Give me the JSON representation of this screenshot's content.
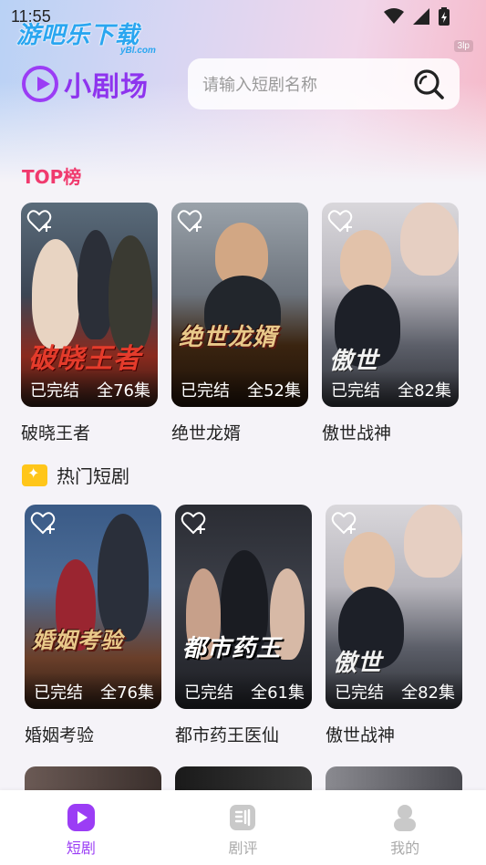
{
  "status_bar": {
    "time": "11:55"
  },
  "watermark": {
    "text": "游吧乐下载",
    "sub": "yBl.com"
  },
  "corner_badge": "3lp",
  "brand": {
    "name": "小剧场"
  },
  "search": {
    "placeholder": "请输入短剧名称"
  },
  "top_section": {
    "title": "TOP榜",
    "items": [
      {
        "title": "破晓王者",
        "art_title": "破晓王者",
        "status": "已完结",
        "episodes": "全76集"
      },
      {
        "title": "绝世龙婿",
        "art_title": "绝世龙婿",
        "status": "已完结",
        "episodes": "全52集"
      },
      {
        "title": "傲世战神",
        "art_title": "傲世",
        "status": "已完结",
        "episodes": "全82集"
      }
    ]
  },
  "hot_section": {
    "title": "热门短剧",
    "items": [
      {
        "title": "婚姻考验",
        "art_title": "婚姻考验",
        "status": "已完结",
        "episodes": "全76集"
      },
      {
        "title": "都市药王医仙",
        "art_title": "都市药王",
        "status": "已完结",
        "episodes": "全61集"
      },
      {
        "title": "傲世战神",
        "art_title": "傲世",
        "status": "已完结",
        "episodes": "全82集"
      }
    ]
  },
  "tabbar": {
    "items": [
      {
        "label": "短剧",
        "icon": "play-icon",
        "active": true
      },
      {
        "label": "剧评",
        "icon": "review-icon",
        "active": false
      },
      {
        "label": "我的",
        "icon": "profile-icon",
        "active": false
      }
    ]
  },
  "colors": {
    "accent": "#9b3df5",
    "top_title": "#f03a6e",
    "hot_badge": "#ffc61a"
  }
}
